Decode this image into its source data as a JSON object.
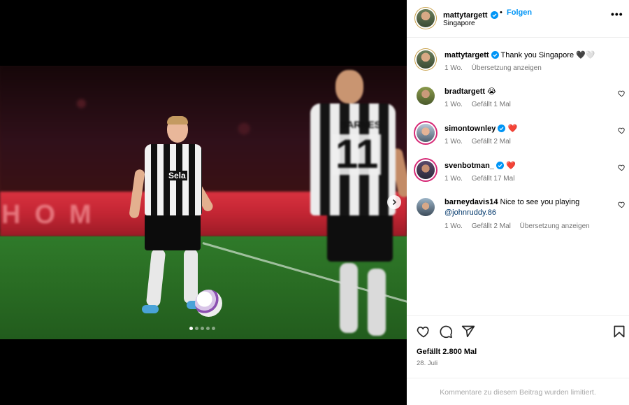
{
  "post": {
    "author": "mattytargett",
    "follow_label": "Folgen",
    "separator": "•",
    "location": "Singapore",
    "more_label": "•••",
    "carousel": {
      "dot_count": 5,
      "active_index": 0
    },
    "photo": {
      "board_text": "HOM",
      "sponsor_text": "Sela",
      "player_number": "11",
      "player_name": "BARNES"
    }
  },
  "caption": {
    "author": "mattytargett",
    "text": "Thank you Singapore 🖤🤍",
    "time": "1 Wo.",
    "translate": "Übersetzung anzeigen"
  },
  "comments": [
    {
      "author": "bradtargett",
      "text": "😭",
      "time": "1 Wo.",
      "likes": "Gefällt 1 Mal",
      "verified": false
    },
    {
      "author": "simontownley",
      "text": "❤️",
      "time": "1 Wo.",
      "likes": "Gefällt 2 Mal",
      "verified": true
    },
    {
      "author": "svenbotman_",
      "text": "❤️",
      "time": "1 Wo.",
      "likes": "Gefällt 17 Mal",
      "verified": true
    },
    {
      "author": "barneydavis14",
      "text": "Nice to see you playing",
      "mention": "@johnruddy.86",
      "time": "1 Wo.",
      "likes": "Gefällt 2 Mal",
      "translate": "Übersetzung anzeigen",
      "verified": false
    }
  ],
  "footer": {
    "likes": "Gefällt 2.800 Mal",
    "date": "28. Juli",
    "limited": "Kommentare zu diesem Beitrag wurden limitiert."
  },
  "icons": [
    "heart-icon",
    "comment-icon",
    "share-icon",
    "bookmark-icon",
    "verified-icon",
    "more-icon",
    "chevron-right-icon"
  ],
  "colors": {
    "accent": "#0095f6",
    "verified": "#0095f6",
    "muted": "#737373"
  }
}
